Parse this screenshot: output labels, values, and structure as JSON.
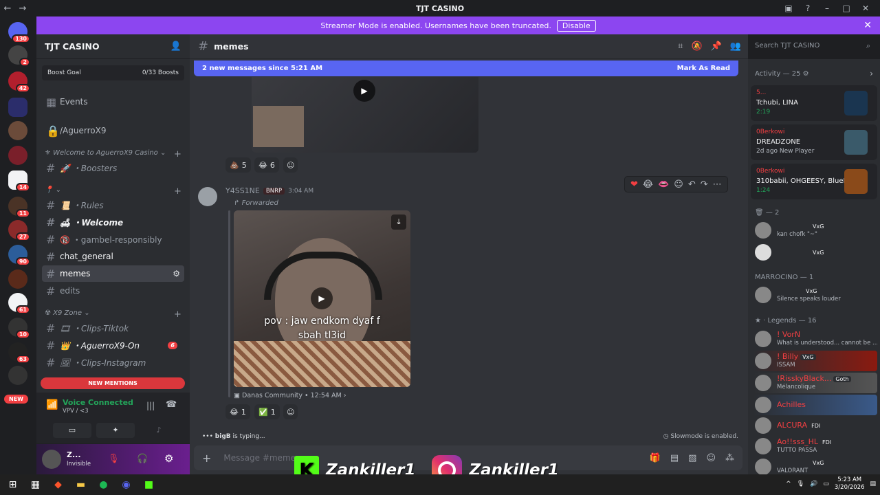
{
  "window": {
    "title": "TJT CASINO",
    "back": "←",
    "forward": "→"
  },
  "notice": {
    "text": "Streamer Mode is enabled. Usernames have been truncated.",
    "button": "Disable"
  },
  "rail": {
    "badges": [
      "130",
      "2",
      "42",
      "14",
      "11",
      "27",
      "90",
      "61",
      "10",
      "63"
    ],
    "new_label": "NEW"
  },
  "server": {
    "name": "TJT CASINO",
    "boost_goal": "Boost Goal",
    "boost_count": "0/33 Boosts",
    "events": "Events",
    "channels": [
      {
        "label": "/AguerroX9"
      },
      {
        "label": "Welcome to AguerroX9 Casino"
      },
      {
        "label": "🚀 ・Boosters"
      },
      {
        "label": "📜 ・Rules"
      },
      {
        "label": "🛋 ・Welcome"
      },
      {
        "label": "🔞 ・gambel-responsibly"
      },
      {
        "label": "chat_general"
      },
      {
        "label": "memes"
      },
      {
        "label": "edits"
      },
      {
        "label": "X9 Zone"
      },
      {
        "label": "🎞 ・Clips-Tiktok"
      },
      {
        "label": "👑 ・AguerroX9-On"
      },
      {
        "label": "🖼 ・Clips-Instagram"
      }
    ],
    "aguerro_badge": "6",
    "new_mentions": "NEW MENTIONS"
  },
  "voice": {
    "status": "Voice Connected",
    "channel": "VPV",
    "sub": "/ <3"
  },
  "user": {
    "name": "Z...",
    "status": "Invisible"
  },
  "channel": {
    "name": "memes"
  },
  "newbar": {
    "text": "2 new messages since 5:21 AM",
    "action": "Mark As Read"
  },
  "msg1": {
    "reactions": [
      {
        "e": "💩",
        "c": "5"
      },
      {
        "e": "😂",
        "c": "6"
      }
    ]
  },
  "msg2": {
    "author": "Y4SS1NE",
    "tag": "BNRP",
    "time": "3:04 AM",
    "forwarded": "Forwarded",
    "caption_line1": "pov : jaw endkom dyaf f",
    "caption_line2": "sbah tl3id",
    "source": "Danas Community",
    "source_time": "12:54 AM",
    "reactions": [
      {
        "e": "😂",
        "c": "1"
      },
      {
        "e": "✅",
        "c": "1"
      }
    ]
  },
  "typing": {
    "user": "bigB",
    "text": "is typing..."
  },
  "slowmode": "Slowmode is enabled.",
  "composer": {
    "placeholder": "Message #memes"
  },
  "overlay": {
    "kick": "Zankiller1",
    "instagram": "Zankiller1"
  },
  "search": {
    "placeholder": "Search TJT CASINO"
  },
  "members": {
    "activity_header": "Activity — 25",
    "activities": [
      {
        "who": "5...",
        "name": "Tchubi, LINA",
        "sub": "2:19"
      },
      {
        "who": "0Berkowi",
        "name": "DREADZONE",
        "sub": "2d ago  New Player"
      },
      {
        "who": "0Berkowi",
        "name": "310babii, OHGEESY, BlueB...",
        "sub": "1:24"
      }
    ],
    "group1": "— 2",
    "g1": [
      {
        "role": "VxG",
        "sub": "kan chofk \"~\""
      },
      {
        "role": "VxG",
        "sub": ""
      }
    ],
    "group2": "MARROCINO — 1",
    "g2": [
      {
        "role": "VxG",
        "sub": "Silence speaks louder"
      }
    ],
    "group3": "Legends — 16",
    "g3": [
      {
        "name": "! VorN",
        "role": "",
        "sub": "What is understood... cannot be ..."
      },
      {
        "name": "! Billy",
        "role": "VxG",
        "sub": "ISSAM"
      },
      {
        "name": "!RisskyBlack...",
        "role": "Goth",
        "sub": "Mélancolique"
      },
      {
        "name": "Achilles",
        "role": "",
        "sub": ""
      },
      {
        "name": "ALCURA",
        "role": "FDI",
        "sub": ""
      },
      {
        "name": "Ao!!sss_HL",
        "role": "FDI",
        "sub": "TUTTO PASSA"
      },
      {
        "name": "",
        "role": "VxG",
        "sub": "VALORANT"
      }
    ]
  },
  "taskbar": {
    "time": "5:23 AM",
    "date": "3/20/2026"
  }
}
